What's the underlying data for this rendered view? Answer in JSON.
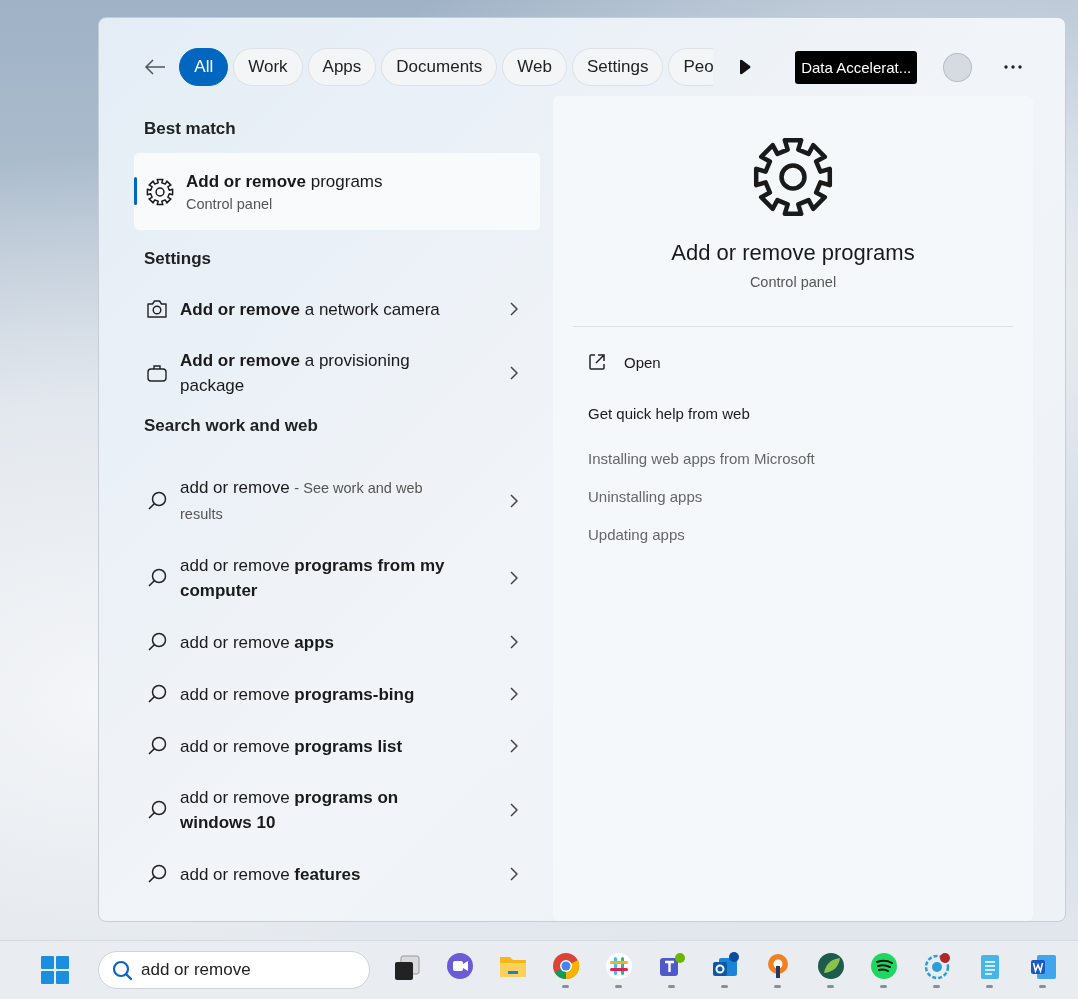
{
  "filters": {
    "tabs": [
      {
        "label": "All",
        "selected": true
      },
      {
        "label": "Work",
        "selected": false
      },
      {
        "label": "Apps",
        "selected": false
      },
      {
        "label": "Documents",
        "selected": false
      },
      {
        "label": "Web",
        "selected": false
      },
      {
        "label": "Settings",
        "selected": false
      },
      {
        "label": "Peo",
        "selected": false
      }
    ],
    "org_badge": "Data Accelerat..."
  },
  "best_match": {
    "heading": "Best match",
    "item": {
      "title": "**Add or remove** programs",
      "subtitle": "Control panel",
      "selected": true
    }
  },
  "settings": {
    "heading": "Settings",
    "items": [
      {
        "kind": "camera",
        "title": "**Add or remove** a network camera"
      },
      {
        "kind": "package",
        "title": "**Add or remove** a provisioning package"
      }
    ]
  },
  "web": {
    "heading": "Search work and web",
    "items": [
      {
        "title": "add or remove",
        "hint": "- See work and web results"
      },
      {
        "title": "add or remove **programs from my computer**"
      },
      {
        "title": "add or remove **apps**"
      },
      {
        "title": "add or remove **programs-bing**"
      },
      {
        "title": "add or remove **programs list**"
      },
      {
        "title": "add or remove **programs on windows 10**"
      },
      {
        "title": "add or remove **features**"
      }
    ]
  },
  "preview": {
    "title": "Add or remove programs",
    "subtitle": "Control panel",
    "action": "Open",
    "help_heading": "Get quick help from web",
    "links": [
      "Installing web apps from Microsoft",
      "Uninstalling apps",
      "Updating apps"
    ]
  },
  "taskbar": {
    "search_value": "add or remove",
    "apps": [
      {
        "kind": "taskview",
        "running": false
      },
      {
        "kind": "chat",
        "running": false
      },
      {
        "kind": "folder",
        "running": false
      },
      {
        "kind": "chrome",
        "running": true
      },
      {
        "kind": "slack",
        "running": true
      },
      {
        "kind": "teams",
        "running": true
      },
      {
        "kind": "outlook",
        "running": true
      },
      {
        "kind": "vpn",
        "running": true
      },
      {
        "kind": "leaf",
        "running": true
      },
      {
        "kind": "spotify",
        "running": true
      },
      {
        "kind": "hub",
        "running": true
      },
      {
        "kind": "notepad",
        "running": true
      },
      {
        "kind": "word",
        "running": true
      }
    ]
  }
}
